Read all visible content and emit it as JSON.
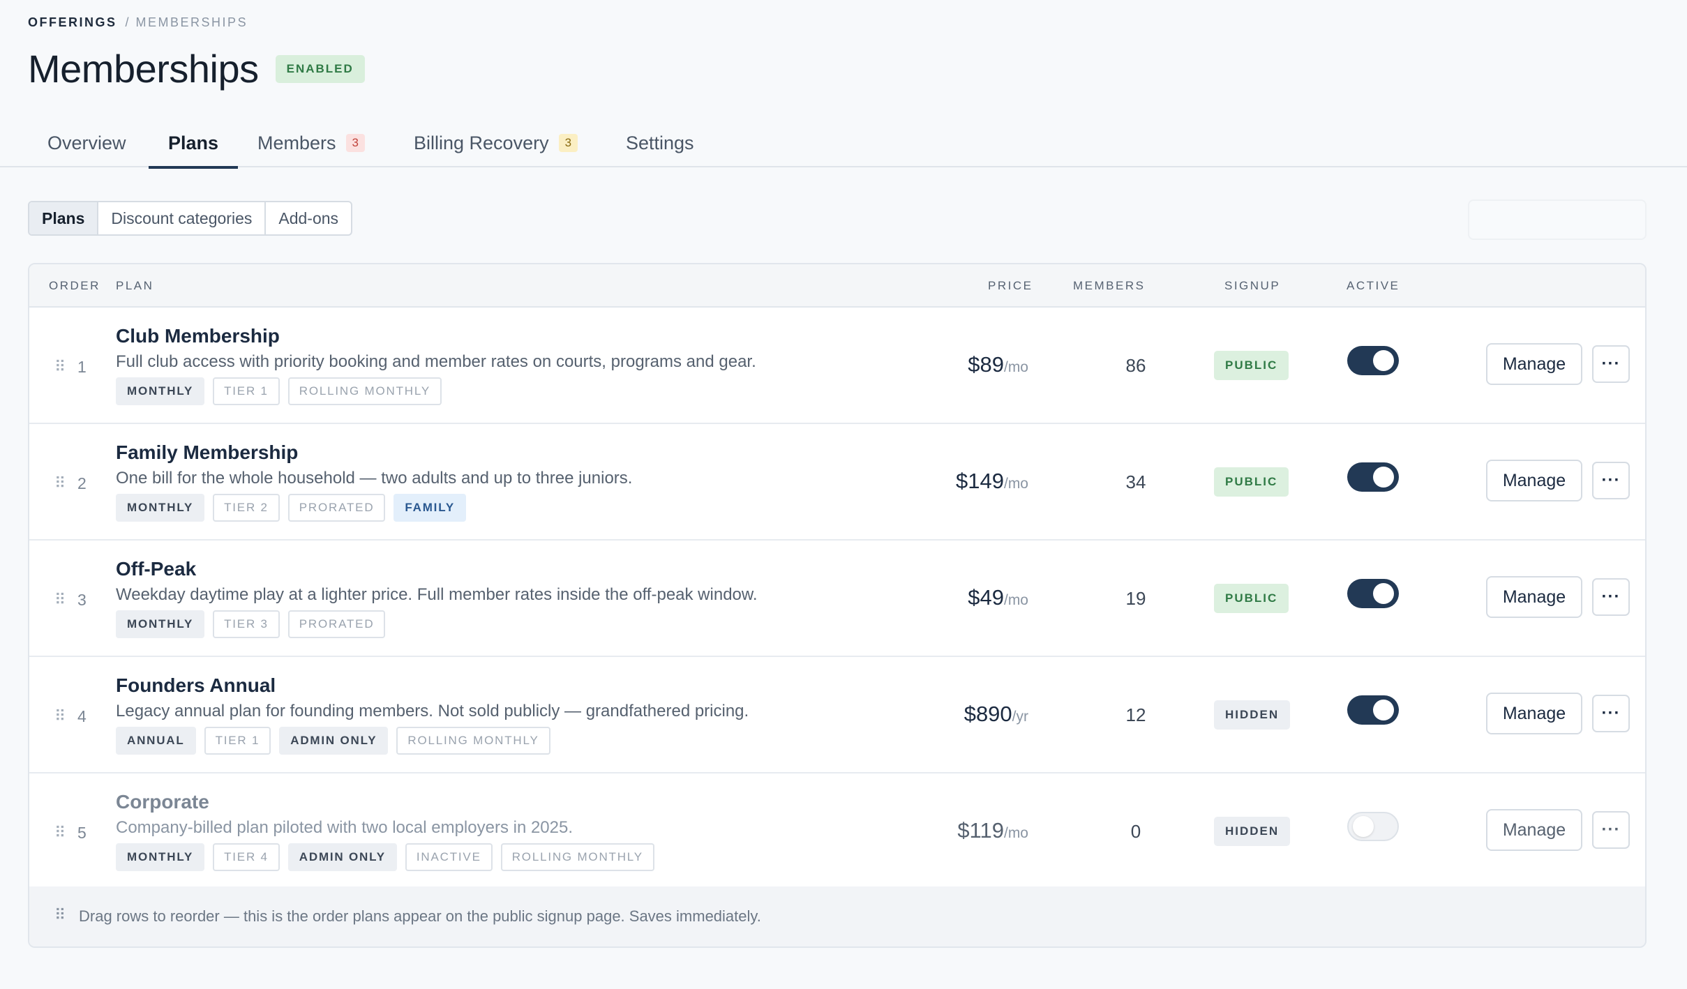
{
  "breadcrumb": {
    "root": "OFFERINGS",
    "separator": "/",
    "current": "MEMBERSHIPS"
  },
  "page": {
    "title": "Memberships",
    "status_badge": "ENABLED"
  },
  "tabs": [
    {
      "label": "Overview",
      "count": ""
    },
    {
      "label": "Plans",
      "count": "",
      "active": true
    },
    {
      "label": "Members",
      "count": "3"
    },
    {
      "label": "Billing Recovery",
      "count": "3"
    },
    {
      "label": "Settings",
      "count": ""
    }
  ],
  "subtabs": [
    {
      "label": "Plans",
      "active": true
    },
    {
      "label": "Discount categories"
    },
    {
      "label": "Add-ons"
    }
  ],
  "table": {
    "headers": {
      "order": "ORDER",
      "plan": "PLAN",
      "price": "PRICE",
      "members": "MEMBERS",
      "signup": "SIGNUP",
      "active": "ACTIVE"
    },
    "manage_label": "Manage",
    "more_label": "···",
    "rows": [
      {
        "order": "1",
        "name": "Club Membership",
        "description": "Full club access with priority booking and member rates on courts, programs and gear.",
        "tags": [
          "MONTHLY",
          "TIER 1",
          "ROLLING MONTHLY"
        ],
        "price": "$89",
        "period": "/mo",
        "members": "86",
        "signup": "PUBLIC",
        "active": true
      },
      {
        "order": "2",
        "name": "Family Membership",
        "description": "One bill for the whole household — two adults and up to three juniors.",
        "tags": [
          "MONTHLY",
          "TIER 2",
          "PRORATED",
          "FAMILY"
        ],
        "price": "$149",
        "period": "/mo",
        "members": "34",
        "signup": "PUBLIC",
        "active": true
      },
      {
        "order": "3",
        "name": "Off-Peak",
        "description": "Weekday daytime play at a lighter price. Full member rates inside the off-peak window.",
        "tags": [
          "MONTHLY",
          "TIER 3",
          "PRORATED"
        ],
        "price": "$49",
        "period": "/mo",
        "members": "19",
        "signup": "PUBLIC",
        "active": true
      },
      {
        "order": "4",
        "name": "Founders Annual",
        "description": "Legacy annual plan for founding members. Not sold publicly — grandfathered pricing.",
        "tags": [
          "ANNUAL",
          "TIER 1",
          "ADMIN ONLY",
          "ROLLING MONTHLY"
        ],
        "price": "$890",
        "period": "/yr",
        "members": "12",
        "signup": "HIDDEN",
        "active": true
      },
      {
        "order": "5",
        "name": "Corporate",
        "description": "Company-billed plan piloted with two local employers in 2025.",
        "tags": [
          "MONTHLY",
          "TIER 4",
          "ADMIN ONLY",
          "INACTIVE",
          "ROLLING MONTHLY"
        ],
        "price": "$119",
        "period": "/mo",
        "members": "0",
        "signup": "HIDDEN",
        "active": false
      }
    ]
  },
  "footer": {
    "hint": "Drag rows to reorder — this is the order plans appear on the public signup page. Saves immediately."
  },
  "colors": {
    "accent": "#223955",
    "public_bg": "#dcf0df",
    "public_fg": "#2f7a45",
    "count_red": "#c0433b",
    "count_yellow": "#8a6a10"
  }
}
